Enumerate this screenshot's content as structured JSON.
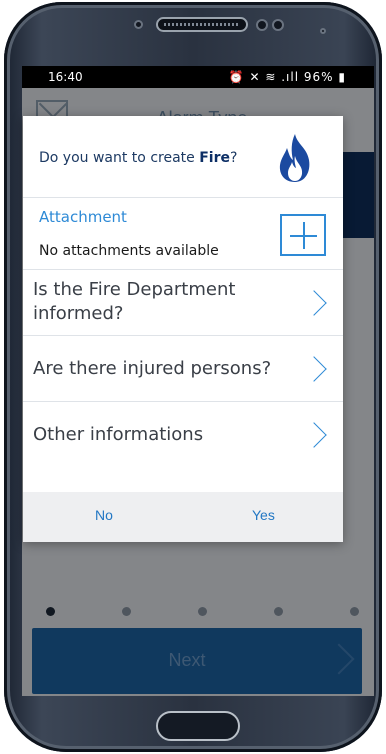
{
  "status_bar": {
    "time": "16:40",
    "icons_text": "⏰ ✕ ≋ .ıll",
    "battery": "96%"
  },
  "header": {
    "title": "Alarm Type"
  },
  "dialog": {
    "question_prefix": "Do you want to create ",
    "question_bold": "Fire",
    "question_suffix": "?",
    "attachment_title": "Attachment",
    "attachment_status": "No attachments available",
    "rows": [
      {
        "label_line1": "Is the Fire Department",
        "label_line2": "informed?"
      },
      {
        "label_line1": "Are there injured persons?"
      },
      {
        "label_line1": "Other informations"
      }
    ],
    "no_label": "No",
    "yes_label": "Yes"
  },
  "footer": {
    "next_label": "Next"
  },
  "colors": {
    "accent_blue": "#2e8ad6",
    "dark_navy": "#0f2d5a",
    "next_button": "#1c63a2",
    "flame": "#1b4aa0"
  }
}
